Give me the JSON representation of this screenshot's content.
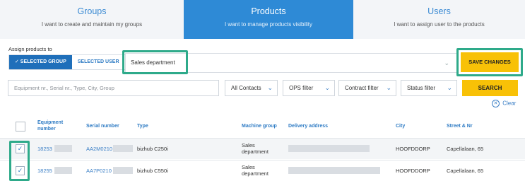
{
  "tabs": [
    {
      "title": "Groups",
      "subtitle": "I want to create and maintain my groups"
    },
    {
      "title": "Products",
      "subtitle": "I want to manage products visibility"
    },
    {
      "title": "Users",
      "subtitle": "I want to assign user to the products"
    }
  ],
  "assign": {
    "label": "Assign products to",
    "selected_group": "✓ SELECTED GROUP",
    "selected_user": "SELECTED USER",
    "group_value": "Sales department",
    "save_label": "SAVE CHANGES"
  },
  "filters": {
    "search_placeholder": "Equipment nr., Serial nr., Type, City, Group",
    "contacts": "All Contacts",
    "ops": "OPS filter",
    "contract": "Contract filter",
    "status": "Status filter",
    "search_label": "SEARCH",
    "clear_label": "Clear"
  },
  "table": {
    "headers": {
      "equipment_1": "Equipment",
      "equipment_2": "number",
      "serial": "Serial number",
      "type": "Type",
      "machine_group": "Machine group",
      "delivery": "Delivery address",
      "city": "City",
      "street": "Street & Nr"
    },
    "rows": [
      {
        "checked": "✓",
        "equipment": "18253",
        "serial": "AA2M0210",
        "type": "bizhub C250i",
        "group_1": "Sales",
        "group_2": "department",
        "city": "HOOFDDORP",
        "street": "Capellalaan, 65"
      },
      {
        "checked": "✓",
        "equipment": "18255",
        "serial": "AA7P0210",
        "type": "bizhub C550i",
        "group_1": "Sales",
        "group_2": "department",
        "city": "HOOFDDORP",
        "street": "Capellalaan, 65"
      }
    ]
  },
  "colors": {
    "tab_active": "#2e8ad6",
    "accent_yellow": "#f8c107",
    "highlight_green": "#2eaa8a",
    "link_blue": "#3b7fc6"
  },
  "icons": {
    "dropdown": "chevron-down-icon",
    "check": "check-icon",
    "clear": "close-circle-icon"
  }
}
